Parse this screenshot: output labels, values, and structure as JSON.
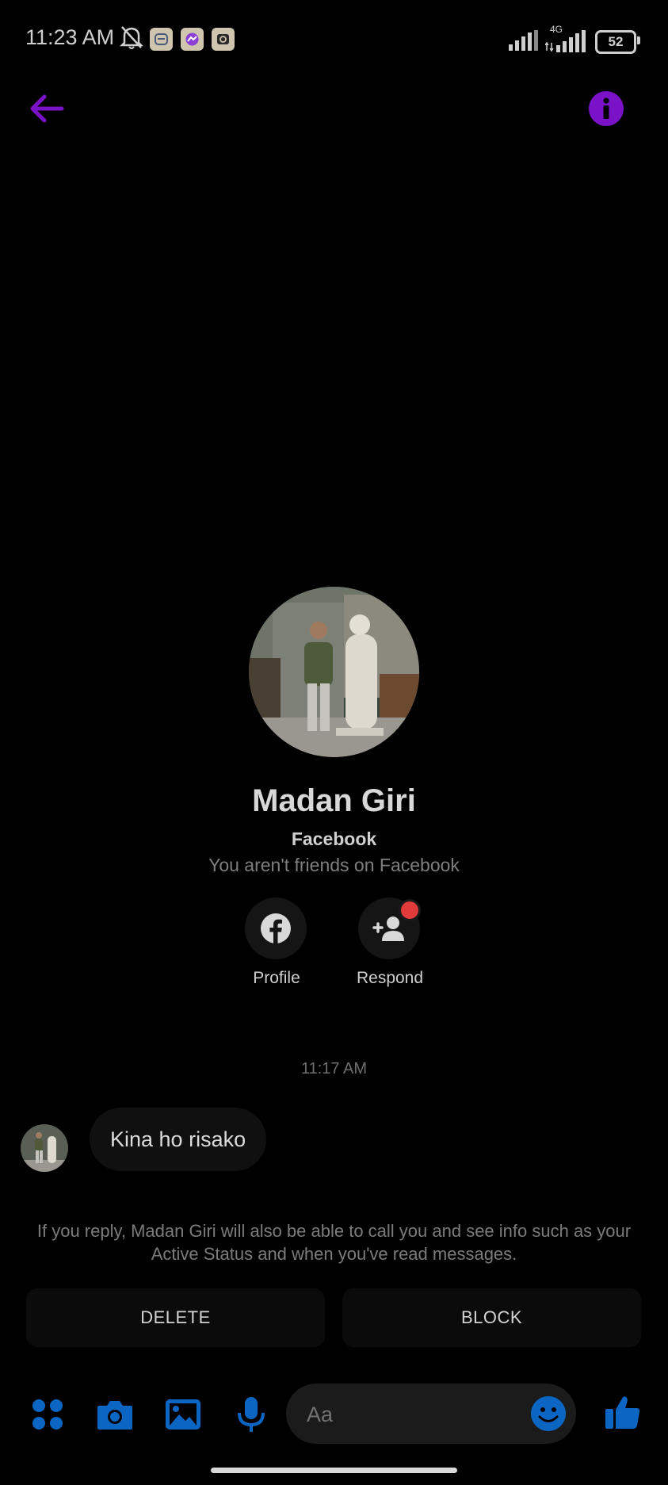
{
  "status_bar": {
    "time": "11:23 AM",
    "battery": "52",
    "network": "4G",
    "icons": [
      "mute-bell-icon",
      "app-badge-icon",
      "messenger-badge-icon",
      "camera-badge-icon",
      "signal-icon",
      "signal-4g-icon",
      "battery-icon"
    ]
  },
  "header": {
    "back_icon": "arrow-left-icon",
    "info_icon": "info-icon"
  },
  "profile": {
    "name": "Madan Giri",
    "platform": "Facebook",
    "relationship": "You aren't friends on Facebook",
    "actions": [
      {
        "label": "Profile",
        "icon": "facebook-icon"
      },
      {
        "label": "Respond",
        "icon": "add-friend-icon"
      }
    ]
  },
  "conversation": {
    "timestamp": "11:17 AM",
    "messages": [
      {
        "sender": "Madan Giri",
        "text": "Kina ho risako"
      }
    ]
  },
  "request_notice": {
    "text": "If you reply, Madan Giri will also be able to call you and see info such as your Active Status and when you've read messages.",
    "delete_label": "DELETE",
    "block_label": "BLOCK"
  },
  "composer": {
    "placeholder": "Aa",
    "icons": [
      "apps-icon",
      "camera-icon",
      "gallery-icon",
      "microphone-icon",
      "emoji-icon",
      "thumbs-up-icon"
    ]
  },
  "colors": {
    "accent_purple": "#7a12c7",
    "accent_blue": "#0a66c2",
    "background": "#000000",
    "notification_red": "#e23b3b"
  }
}
